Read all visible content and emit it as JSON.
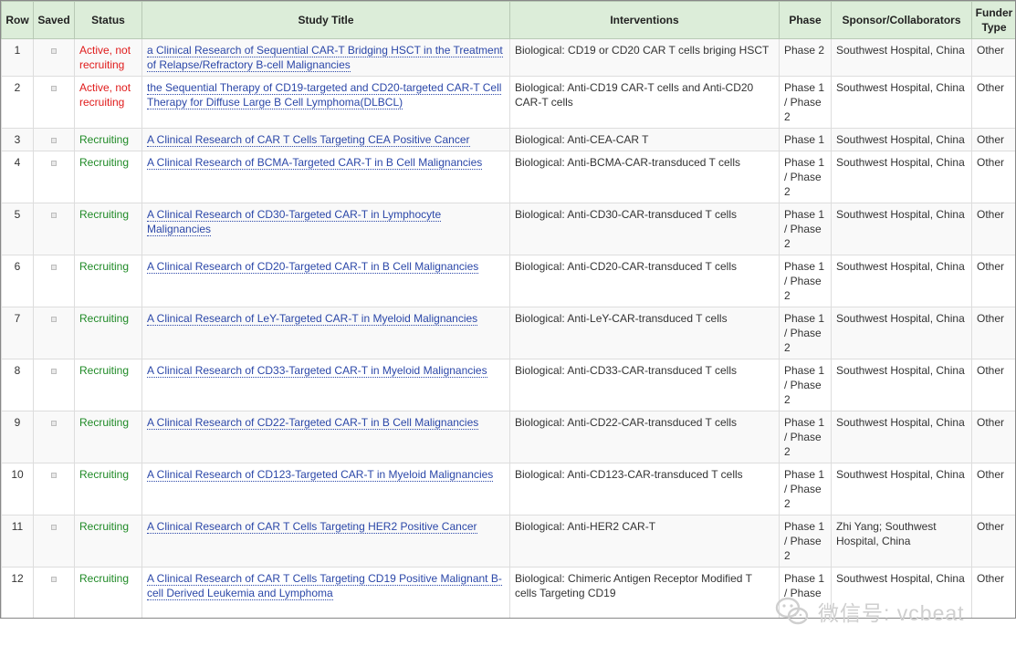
{
  "headers": [
    "Row",
    "Saved",
    "Status",
    "Study Title",
    "Interventions",
    "Phase",
    "Sponsor/Collaborators",
    "Funder Type"
  ],
  "rows": [
    {
      "row": "1",
      "status": "Active, not recruiting",
      "status_color": "red",
      "title": "a Clinical Research of Sequential CAR-T Bridging HSCT in the Treatment of Relapse/Refractory B-cell Malignancies",
      "interventions": "Biological: CD19 or CD20 CAR T cells briging HSCT",
      "phase": "Phase 2",
      "sponsor": "Southwest Hospital, China",
      "funder": "Other"
    },
    {
      "row": "2",
      "status": "Active, not recruiting",
      "status_color": "red",
      "title": "the Sequential Therapy of CD19-targeted and CD20-targeted CAR-T Cell Therapy for Diffuse Large B Cell Lymphoma(DLBCL)",
      "interventions": "Biological: Anti-CD19 CAR-T cells and Anti-CD20 CAR-T cells",
      "phase": "Phase 1 / Phase 2",
      "sponsor": "Southwest Hospital, China",
      "funder": "Other"
    },
    {
      "row": "3",
      "status": "Recruiting",
      "status_color": "green",
      "title": "A Clinical Research of CAR T Cells Targeting CEA Positive Cancer",
      "interventions": "Biological: Anti-CEA-CAR T",
      "phase": "Phase 1",
      "sponsor": "Southwest Hospital, China",
      "funder": "Other"
    },
    {
      "row": "4",
      "status": "Recruiting",
      "status_color": "green",
      "title": "A Clinical Research of BCMA-Targeted CAR-T in B Cell Malignancies",
      "interventions": "Biological: Anti-BCMA-CAR-transduced T cells",
      "phase": "Phase 1 / Phase 2",
      "sponsor": "Southwest Hospital, China",
      "funder": "Other"
    },
    {
      "row": "5",
      "status": "Recruiting",
      "status_color": "green",
      "title": "A Clinical Research of CD30-Targeted CAR-T in Lymphocyte Malignancies",
      "interventions": "Biological: Anti-CD30-CAR-transduced T cells",
      "phase": "Phase 1 / Phase 2",
      "sponsor": "Southwest Hospital, China",
      "funder": "Other"
    },
    {
      "row": "6",
      "status": "Recruiting",
      "status_color": "green",
      "title": "A Clinical Research of CD20-Targeted CAR-T in B Cell Malignancies",
      "interventions": "Biological: Anti-CD20-CAR-transduced T cells",
      "phase": "Phase 1 / Phase 2",
      "sponsor": "Southwest Hospital, China",
      "funder": "Other"
    },
    {
      "row": "7",
      "status": "Recruiting",
      "status_color": "green",
      "title": "A Clinical Research of LeY-Targeted CAR-T in Myeloid Malignancies",
      "interventions": "Biological: Anti-LeY-CAR-transduced T cells",
      "phase": "Phase 1 / Phase 2",
      "sponsor": "Southwest Hospital, China",
      "funder": "Other"
    },
    {
      "row": "8",
      "status": "Recruiting",
      "status_color": "green",
      "title": "A Clinical Research of CD33-Targeted CAR-T in Myeloid Malignancies",
      "interventions": "Biological: Anti-CD33-CAR-transduced T cells",
      "phase": "Phase 1 / Phase 2",
      "sponsor": "Southwest Hospital, China",
      "funder": "Other"
    },
    {
      "row": "9",
      "status": "Recruiting",
      "status_color": "green",
      "title": "A Clinical Research of CD22-Targeted CAR-T in B Cell Malignancies",
      "interventions": "Biological: Anti-CD22-CAR-transduced T cells",
      "phase": "Phase 1 / Phase 2",
      "sponsor": "Southwest Hospital, China",
      "funder": "Other"
    },
    {
      "row": "10",
      "status": "Recruiting",
      "status_color": "green",
      "title": "A Clinical Research of CD123-Targeted CAR-T in Myeloid Malignancies",
      "interventions": "Biological: Anti-CD123-CAR-transduced T cells",
      "phase": "Phase 1 / Phase 2",
      "sponsor": "Southwest Hospital, China",
      "funder": "Other"
    },
    {
      "row": "11",
      "status": "Recruiting",
      "status_color": "green",
      "title": "A Clinical Research of CAR T Cells Targeting HER2 Positive Cancer",
      "interventions": "Biological: Anti-HER2 CAR-T",
      "phase": "Phase 1 / Phase 2",
      "sponsor": "Zhi Yang; Southwest Hospital, China",
      "funder": "Other"
    },
    {
      "row": "12",
      "status": "Recruiting",
      "status_color": "green",
      "title": "A Clinical Research of CAR T Cells Targeting CD19 Positive Malignant B-cell Derived Leukemia and Lymphoma",
      "interventions": "Biological: Chimeric Antigen Receptor Modified T cells Targeting CD19",
      "phase": "Phase 1 / Phase",
      "sponsor": "Southwest Hospital, China",
      "funder": "Other"
    }
  ],
  "watermark": {
    "text": "微信号: vcbeat",
    "icon": "wechat-icon"
  },
  "colors": {
    "header_bg": "#dcedd9",
    "status_red": "#e01b1b",
    "status_green": "#1f8a26",
    "link": "#2b47a8"
  }
}
